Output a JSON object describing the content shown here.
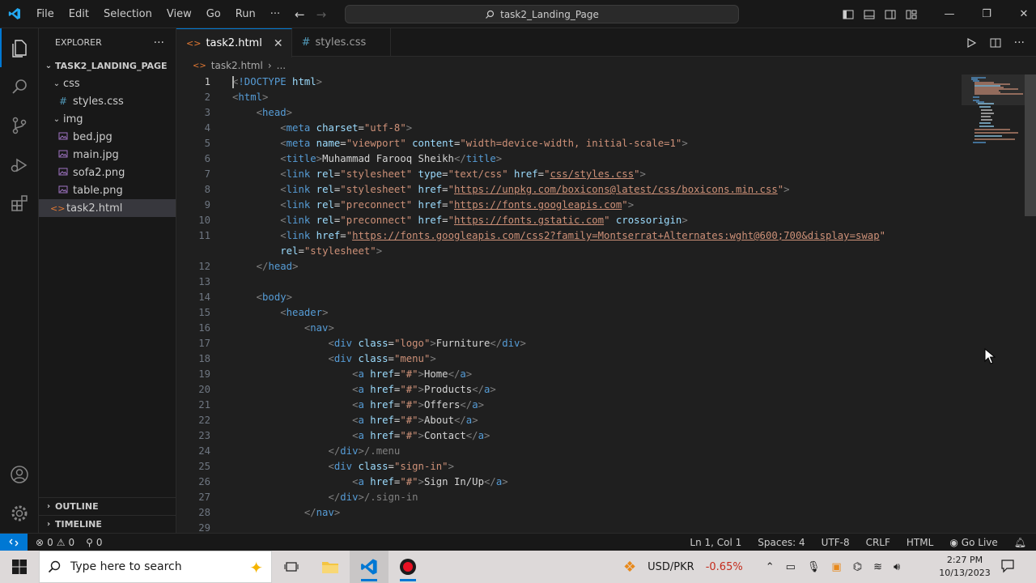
{
  "titlebar": {
    "menu": [
      "File",
      "Edit",
      "Selection",
      "View",
      "Go",
      "Run",
      "···"
    ],
    "search_text": "task2_Landing_Page"
  },
  "sidebar": {
    "title": "EXPLORER",
    "more": "···",
    "root": "TASK2_LANDING_PAGE",
    "tree": [
      {
        "label": "css",
        "type": "folder",
        "depth": 1
      },
      {
        "label": "styles.css",
        "type": "css",
        "depth": 2
      },
      {
        "label": "img",
        "type": "folder",
        "depth": 1
      },
      {
        "label": "bed.jpg",
        "type": "image",
        "depth": 2
      },
      {
        "label": "main.jpg",
        "type": "image",
        "depth": 2
      },
      {
        "label": "sofa2.png",
        "type": "image",
        "depth": 2
      },
      {
        "label": "table.png",
        "type": "image",
        "depth": 2
      },
      {
        "label": "task2.html",
        "type": "html",
        "depth": 1,
        "selected": true
      }
    ],
    "outline": "OUTLINE",
    "timeline": "TIMELINE"
  },
  "tabs": [
    {
      "label": "task2.html",
      "icon": "<>",
      "active": true
    },
    {
      "label": "styles.css",
      "icon": "#",
      "active": false
    }
  ],
  "breadcrumb": {
    "file": "task2.html",
    "more": "..."
  },
  "code": [
    {
      "n": "1",
      "cur": true,
      "html": "<span class='p'>&lt;</span><span class='t'>!DOCTYPE</span> <span class='a'>html</span><span class='p'>&gt;</span>"
    },
    {
      "n": "2",
      "html": "<span class='p'>&lt;</span><span class='t'>html</span><span class='p'>&gt;</span>"
    },
    {
      "n": "3",
      "html": "    <span class='p'>&lt;</span><span class='t'>head</span><span class='p'>&gt;</span>"
    },
    {
      "n": "4",
      "html": "        <span class='p'>&lt;</span><span class='t'>meta</span> <span class='a'>charset</span><span class='x'>=</span><span class='s'>\"utf-8\"</span><span class='p'>&gt;</span>"
    },
    {
      "n": "5",
      "html": "        <span class='p'>&lt;</span><span class='t'>meta</span> <span class='a'>name</span><span class='x'>=</span><span class='s'>\"viewport\"</span> <span class='a'>content</span><span class='x'>=</span><span class='s'>\"width=device-width, initial-scale=1\"</span><span class='p'>&gt;</span>"
    },
    {
      "n": "6",
      "html": "        <span class='p'>&lt;</span><span class='t'>title</span><span class='p'>&gt;</span><span class='x'>Muhammad Farooq Sheikh</span><span class='p'>&lt;/</span><span class='t'>title</span><span class='p'>&gt;</span>"
    },
    {
      "n": "7",
      "html": "        <span class='p'>&lt;</span><span class='t'>link</span> <span class='a'>rel</span><span class='x'>=</span><span class='s'>\"stylesheet\"</span> <span class='a'>type</span><span class='x'>=</span><span class='s'>\"text/css\"</span> <span class='a'>href</span><span class='x'>=</span><span class='s'>\"</span><span class='u'>css/styles.css</span><span class='s'>\"</span><span class='p'>&gt;</span>"
    },
    {
      "n": "8",
      "html": "        <span class='p'>&lt;</span><span class='t'>link</span> <span class='a'>rel</span><span class='x'>=</span><span class='s'>\"stylesheet\"</span> <span class='a'>href</span><span class='x'>=</span><span class='s'>\"</span><span class='u'>https://unpkg.com/boxicons@latest/css/boxicons.min.css</span><span class='s'>\"</span><span class='p'>&gt;</span>"
    },
    {
      "n": "9",
      "html": "        <span class='p'>&lt;</span><span class='t'>link</span> <span class='a'>rel</span><span class='x'>=</span><span class='s'>\"preconnect\"</span> <span class='a'>href</span><span class='x'>=</span><span class='s'>\"</span><span class='u'>https://fonts.googleapis.com</span><span class='s'>\"</span><span class='p'>&gt;</span>"
    },
    {
      "n": "10",
      "html": "        <span class='p'>&lt;</span><span class='t'>link</span> <span class='a'>rel</span><span class='x'>=</span><span class='s'>\"preconnect\"</span> <span class='a'>href</span><span class='x'>=</span><span class='s'>\"</span><span class='u'>https://fonts.gstatic.com</span><span class='s'>\"</span> <span class='a'>crossorigin</span><span class='p'>&gt;</span>"
    },
    {
      "n": "11",
      "html": "        <span class='p'>&lt;</span><span class='t'>link</span> <span class='a'>href</span><span class='x'>=</span><span class='s'>\"</span><span class='u'>https://fonts.googleapis.com/css2?family=Montserrat+Alternates:wght@600;700&amp;display=swap</span><span class='s'>\"</span>"
    },
    {
      "n": "",
      "html": "        <span class='a'>rel</span><span class='x'>=</span><span class='s'>\"stylesheet\"</span><span class='p'>&gt;</span>"
    },
    {
      "n": "12",
      "html": "    <span class='p'>&lt;/</span><span class='t'>head</span><span class='p'>&gt;</span>"
    },
    {
      "n": "13",
      "html": ""
    },
    {
      "n": "14",
      "html": "    <span class='p'>&lt;</span><span class='t'>body</span><span class='p'>&gt;</span>"
    },
    {
      "n": "15",
      "html": "        <span class='p'>&lt;</span><span class='t'>header</span><span class='p'>&gt;</span>"
    },
    {
      "n": "16",
      "html": "            <span class='p'>&lt;</span><span class='t'>nav</span><span class='p'>&gt;</span>"
    },
    {
      "n": "17",
      "html": "                <span class='p'>&lt;</span><span class='t'>div</span> <span class='a'>class</span><span class='x'>=</span><span class='s'>\"logo\"</span><span class='p'>&gt;</span><span class='x'>Furniture</span><span class='p'>&lt;/</span><span class='t'>div</span><span class='p'>&gt;</span>"
    },
    {
      "n": "18",
      "html": "                <span class='p'>&lt;</span><span class='t'>div</span> <span class='a'>class</span><span class='x'>=</span><span class='s'>\"menu\"</span><span class='p'>&gt;</span>"
    },
    {
      "n": "19",
      "html": "                    <span class='p'>&lt;</span><span class='t'>a</span> <span class='a'>href</span><span class='x'>=</span><span class='s'>\"#\"</span><span class='p'>&gt;</span><span class='x'>Home</span><span class='p'>&lt;/</span><span class='t'>a</span><span class='p'>&gt;</span>"
    },
    {
      "n": "20",
      "html": "                    <span class='p'>&lt;</span><span class='t'>a</span> <span class='a'>href</span><span class='x'>=</span><span class='s'>\"#\"</span><span class='p'>&gt;</span><span class='x'>Products</span><span class='p'>&lt;/</span><span class='t'>a</span><span class='p'>&gt;</span>"
    },
    {
      "n": "21",
      "html": "                    <span class='p'>&lt;</span><span class='t'>a</span> <span class='a'>href</span><span class='x'>=</span><span class='s'>\"#\"</span><span class='p'>&gt;</span><span class='x'>Offers</span><span class='p'>&lt;/</span><span class='t'>a</span><span class='p'>&gt;</span>"
    },
    {
      "n": "22",
      "html": "                    <span class='p'>&lt;</span><span class='t'>a</span> <span class='a'>href</span><span class='x'>=</span><span class='s'>\"#\"</span><span class='p'>&gt;</span><span class='x'>About</span><span class='p'>&lt;/</span><span class='t'>a</span><span class='p'>&gt;</span>"
    },
    {
      "n": "23",
      "html": "                    <span class='p'>&lt;</span><span class='t'>a</span> <span class='a'>href</span><span class='x'>=</span><span class='s'>\"#\"</span><span class='p'>&gt;</span><span class='x'>Contact</span><span class='p'>&lt;/</span><span class='t'>a</span><span class='p'>&gt;</span>"
    },
    {
      "n": "24",
      "html": "                <span class='p'>&lt;/</span><span class='t'>div</span><span class='p'>&gt;</span><span class='p'>/.menu</span>"
    },
    {
      "n": "25",
      "html": "                <span class='p'>&lt;</span><span class='t'>div</span> <span class='a'>class</span><span class='x'>=</span><span class='s'>\"sign-in\"</span><span class='p'>&gt;</span>"
    },
    {
      "n": "26",
      "html": "                    <span class='p'>&lt;</span><span class='t'>a</span> <span class='a'>href</span><span class='x'>=</span><span class='s'>\"#\"</span><span class='p'>&gt;</span><span class='x'>Sign In/Up</span><span class='p'>&lt;/</span><span class='t'>a</span><span class='p'>&gt;</span>"
    },
    {
      "n": "27",
      "html": "                <span class='p'>&lt;/</span><span class='t'>div</span><span class='p'>&gt;</span><span class='p'>/.sign-in</span>"
    },
    {
      "n": "28",
      "html": "            <span class='p'>&lt;/</span><span class='t'>nav</span><span class='p'>&gt;</span>"
    },
    {
      "n": "29",
      "html": ""
    }
  ],
  "statusbar": {
    "problems": "0",
    "warnings": "0",
    "ports": "0",
    "position": "Ln 1, Col 1",
    "spaces": "Spaces: 4",
    "encoding": "UTF-8",
    "eol": "CRLF",
    "language": "HTML",
    "live": "Go Live"
  },
  "taskbar": {
    "search_placeholder": "Type here to search",
    "ticker": "USD/PKR",
    "ticker_change": "-0.65%",
    "time": "2:27 PM",
    "date": "10/13/2023"
  },
  "colors": {
    "accent": "#0078d4",
    "ticker_neg": "#c42b1c"
  }
}
